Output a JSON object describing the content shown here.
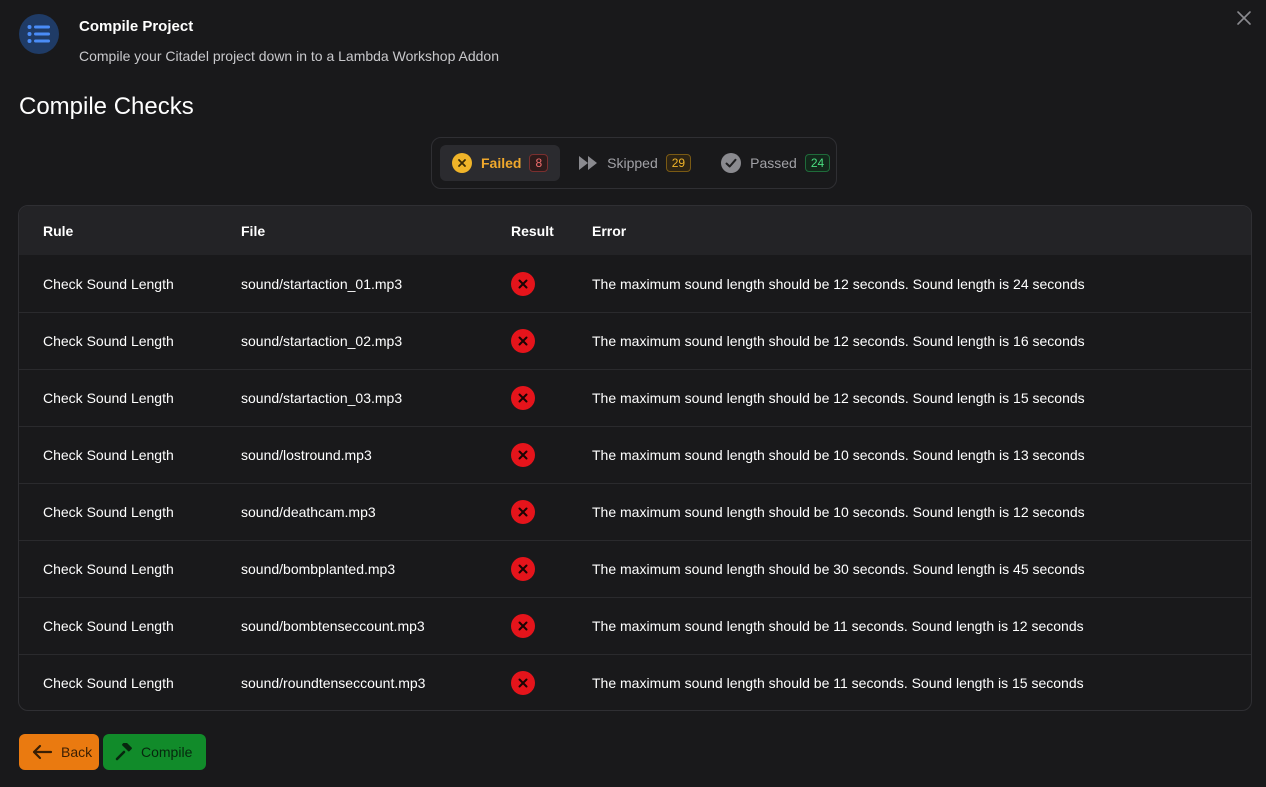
{
  "header": {
    "title": "Compile Project",
    "subtitle": "Compile your Citadel project down in to a Lambda Workshop Addon",
    "icon": "list-icon",
    "icon_color": "#4a8cf7"
  },
  "section_title": "Compile Checks",
  "filters": [
    {
      "label": "Failed",
      "count": "8",
      "icon": "x-circle-icon",
      "active": true
    },
    {
      "label": "Skipped",
      "count": "29",
      "icon": "fast-forward-icon",
      "active": false
    },
    {
      "label": "Passed",
      "count": "24",
      "icon": "check-circle-icon",
      "active": false
    }
  ],
  "table": {
    "headers": {
      "rule": "Rule",
      "file": "File",
      "result": "Result",
      "error": "Error"
    },
    "rows": [
      {
        "rule": "Check Sound Length",
        "file": "sound/startaction_01.mp3",
        "result": "failed",
        "error": "The maximum sound length should be 12 seconds. Sound length is 24 seconds"
      },
      {
        "rule": "Check Sound Length",
        "file": "sound/startaction_02.mp3",
        "result": "failed",
        "error": "The maximum sound length should be 12 seconds. Sound length is 16 seconds"
      },
      {
        "rule": "Check Sound Length",
        "file": "sound/startaction_03.mp3",
        "result": "failed",
        "error": "The maximum sound length should be 12 seconds. Sound length is 15 seconds"
      },
      {
        "rule": "Check Sound Length",
        "file": "sound/lostround.mp3",
        "result": "failed",
        "error": "The maximum sound length should be 10 seconds. Sound length is 13 seconds"
      },
      {
        "rule": "Check Sound Length",
        "file": "sound/deathcam.mp3",
        "result": "failed",
        "error": "The maximum sound length should be 10 seconds. Sound length is 12 seconds"
      },
      {
        "rule": "Check Sound Length",
        "file": "sound/bombplanted.mp3",
        "result": "failed",
        "error": "The maximum sound length should be 30 seconds. Sound length is 45 seconds"
      },
      {
        "rule": "Check Sound Length",
        "file": "sound/bombtenseccount.mp3",
        "result": "failed",
        "error": "The maximum sound length should be 11 seconds. Sound length is 12 seconds"
      },
      {
        "rule": "Check Sound Length",
        "file": "sound/roundtenseccount.mp3",
        "result": "failed",
        "error": "The maximum sound length should be 11 seconds. Sound length is 15 seconds"
      }
    ]
  },
  "buttons": {
    "back_label": "Back",
    "compile_label": "Compile"
  },
  "colors": {
    "failed": "#e5141b",
    "accent_warning": "#f0a82c",
    "back": "#ea7a10",
    "compile": "#118b2a"
  }
}
